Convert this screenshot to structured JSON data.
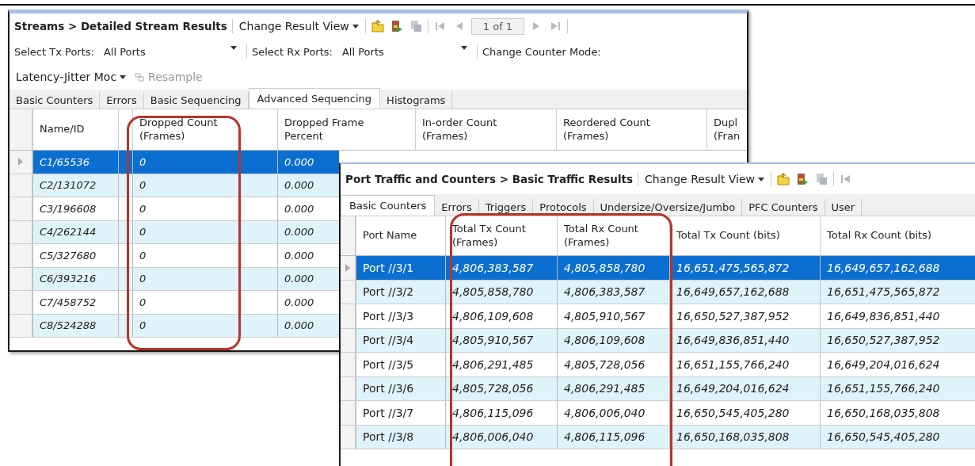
{
  "streams_window": {
    "title": "Streams > Detailed Stream Results",
    "view_menu": "Change Result View",
    "pager": "1 of 1",
    "tx_ports": {
      "label": "Select Tx Ports:",
      "value": "All Ports"
    },
    "rx_ports": {
      "label": "Select Rx Ports:",
      "value": "All Ports"
    },
    "counter_mode": {
      "label": "Change Counter Mode:",
      "value": "Latency-Jitter Moc"
    },
    "resample": {
      "label": "Resample",
      "disabled": true
    },
    "tabs": [
      {
        "label": "Basic Counters",
        "selected": false
      },
      {
        "label": "Errors",
        "selected": false
      },
      {
        "label": "Basic Sequencing",
        "selected": false
      },
      {
        "label": "Advanced Sequencing",
        "selected": true
      },
      {
        "label": "Histograms",
        "selected": false
      }
    ],
    "columns": [
      "Name/ID",
      "",
      "Dropped Count\n(Frames)",
      "Dropped Frame\nPercent",
      "In-order Count\n(Frames)",
      "Reordered Count\n(Frames)",
      "Dupl\n(Fran"
    ],
    "rows": [
      {
        "selected": true,
        "cells": [
          "C1/65536",
          "",
          "0",
          "0.000"
        ]
      },
      {
        "selected": false,
        "cells": [
          "C2/131072",
          "",
          "0",
          "0.000"
        ]
      },
      {
        "selected": false,
        "cells": [
          "C3/196608",
          "",
          "0",
          "0.000"
        ]
      },
      {
        "selected": false,
        "cells": [
          "C4/262144",
          "",
          "0",
          "0.000"
        ]
      },
      {
        "selected": false,
        "cells": [
          "C5/327680",
          "",
          "0",
          "0.000"
        ]
      },
      {
        "selected": false,
        "cells": [
          "C6/393216",
          "",
          "0",
          "0.000"
        ]
      },
      {
        "selected": false,
        "cells": [
          "C7/458752",
          "",
          "0",
          "0.000"
        ]
      },
      {
        "selected": false,
        "cells": [
          "C8/524288",
          "",
          "0",
          "0.000"
        ]
      }
    ]
  },
  "ports_window": {
    "title": "Port Traffic and Counters > Basic Traffic Results",
    "view_menu": "Change Result View",
    "tabs": [
      {
        "label": "Basic Counters",
        "selected": true
      },
      {
        "label": "Errors",
        "selected": false
      },
      {
        "label": "Triggers",
        "selected": false
      },
      {
        "label": "Protocols",
        "selected": false
      },
      {
        "label": "Undersize/Oversize/Jumbo",
        "selected": false
      },
      {
        "label": "PFC Counters",
        "selected": false
      },
      {
        "label": "User",
        "selected": false
      }
    ],
    "columns": [
      "Port Name",
      "Total Tx Count\n(Frames)",
      "Total Rx Count\n(Frames)",
      "Total Tx Count (bits)",
      "Total Rx Count (bits)"
    ],
    "rows": [
      {
        "selected": true,
        "cells": [
          "Port //3/1",
          "4,806,383,587",
          "4,805,858,780",
          "16,651,475,565,872",
          "16,649,657,162,688"
        ]
      },
      {
        "selected": false,
        "cells": [
          "Port //3/2",
          "4,805,858,780",
          "4,806,383,587",
          "16,649,657,162,688",
          "16,651,475,565,872"
        ]
      },
      {
        "selected": false,
        "cells": [
          "Port //3/3",
          "4,806,109,608",
          "4,805,910,567",
          "16,650,527,387,952",
          "16,649,836,851,440"
        ]
      },
      {
        "selected": false,
        "cells": [
          "Port //3/4",
          "4,805,910,567",
          "4,806,109,608",
          "16,649,836,851,440",
          "16,650,527,387,952"
        ]
      },
      {
        "selected": false,
        "cells": [
          "Port //3/5",
          "4,806,291,485",
          "4,805,728,056",
          "16,651,155,766,240",
          "16,649,204,016,624"
        ]
      },
      {
        "selected": false,
        "cells": [
          "Port //3/6",
          "4,805,728,056",
          "4,806,291,485",
          "16,649,204,016,624",
          "16,651,155,766,240"
        ]
      },
      {
        "selected": false,
        "cells": [
          "Port //3/7",
          "4,806,115,096",
          "4,806,006,040",
          "16,650,545,405,280",
          "16,650,168,035,808"
        ]
      },
      {
        "selected": false,
        "cells": [
          "Port //3/8",
          "4,806,006,040",
          "4,806,115,096",
          "16,650,168,035,808",
          "16,650,545,405,280"
        ]
      }
    ]
  }
}
